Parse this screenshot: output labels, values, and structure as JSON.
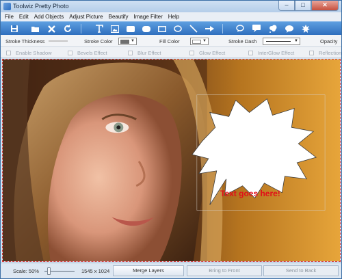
{
  "app": {
    "title": "Toolwiz Pretty Photo"
  },
  "window_controls": {
    "minimize": "‒",
    "maximize": "□",
    "close": "✕"
  },
  "menu": [
    "File",
    "Edit",
    "Add Objects",
    "Adjust Picture",
    "Beautify",
    "Image Filter",
    "Help"
  ],
  "toolbar": {
    "icons": [
      "save-icon",
      "open-folder-icon",
      "delete-icon",
      "refresh-icon",
      "text-icon",
      "image-icon",
      "rounded-rect-icon",
      "filled-rect-icon",
      "rectangle-icon",
      "ellipse-icon",
      "line-icon",
      "arrow-icon",
      "speech-bubble-icon",
      "callout-icon",
      "thought-bubble-icon",
      "cloud-bubble-icon",
      "burst-icon"
    ]
  },
  "properties": {
    "stroke_thickness_label": "Stroke Thickness",
    "stroke_color_label": "Stroke Color",
    "fill_color_label": "Fill Color",
    "stroke_dash_label": "Stroke Dash",
    "opacity_label": "Opacity",
    "stroke_color_value": "#6e6e6e",
    "fill_color_value": "#ffffff"
  },
  "effects": [
    "Enable Shadow",
    "Bevels Effect",
    "Blur Effect",
    "Glow Effect",
    "InterGlow Effect",
    "Reflection"
  ],
  "canvas": {
    "bubble_text": "Text goes here!",
    "bubble_text_color": "#e0101a",
    "selection_color": "#d83c3c"
  },
  "status": {
    "scale_label": "Scale: 50%",
    "zoom_level": 0.1,
    "image_size": "1545 x 1024",
    "merge_layers": "Merge Layers",
    "bring_to_front": "Bring to Front",
    "send_to_back": "Send to Back"
  }
}
